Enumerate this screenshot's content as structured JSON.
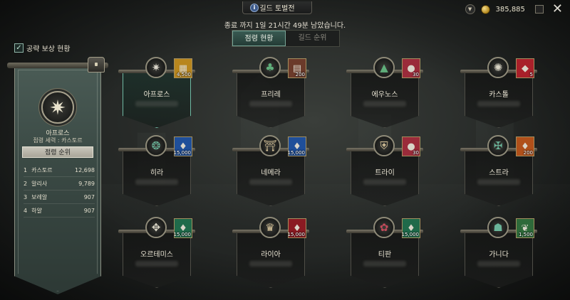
{
  "title": "길드 토벌전",
  "top_right": {
    "currency_value": "385,885"
  },
  "time_text": "종료 까지 1일 21시간 49분 남았습니다.",
  "tabs": [
    {
      "label": "점령 현황",
      "active": true
    },
    {
      "label": "길드 순위",
      "active": false
    }
  ],
  "reward_status_label": "공략 보상 현황",
  "left_panel": {
    "faction_name": "아프로스",
    "faction_sub": "점령 세력 : 카스토르",
    "rank_header": "점령 순위",
    "ranks": [
      {
        "rank": "1",
        "name": "카스토르",
        "score": "12,698"
      },
      {
        "rank": "2",
        "name": "알리사",
        "score": "9,789"
      },
      {
        "rank": "3",
        "name": "보레알",
        "score": "907"
      },
      {
        "rank": "4",
        "name": "하얄",
        "score": "907"
      }
    ]
  },
  "regions": [
    {
      "name": "아프로스",
      "count": "4,500",
      "emblem_icon": "star-emblem-icon",
      "item_icon": "gold-bars-icon",
      "item_color": "#b8861e",
      "selected": true
    },
    {
      "name": "프리레",
      "count": "200",
      "emblem_icon": "leaf-emblem-icon",
      "item_icon": "book-icon",
      "item_color": "#6b3a2a",
      "selected": false
    },
    {
      "name": "에우노스",
      "count": "30",
      "emblem_icon": "triangle-emblem-icon",
      "item_icon": "ore-icon",
      "item_color": "#9a2b3a",
      "selected": false
    },
    {
      "name": "카스톨",
      "count": "5",
      "emblem_icon": "sun-emblem-icon",
      "item_icon": "red-gem-icon",
      "item_color": "#a8202a",
      "selected": false
    },
    {
      "name": "히라",
      "count": "15,000",
      "emblem_icon": "wreath-emblem-icon",
      "item_icon": "blue-crystal-icon",
      "item_color": "#1f4f9a",
      "selected": false
    },
    {
      "name": "네메라",
      "count": "15,000",
      "emblem_icon": "torii-emblem-icon",
      "item_icon": "blue-crystal-icon",
      "item_color": "#1f4f9a",
      "selected": false
    },
    {
      "name": "트라이",
      "count": "30",
      "emblem_icon": "shield-emblem-icon",
      "item_icon": "ore-icon",
      "item_color": "#9a2b3a",
      "selected": false
    },
    {
      "name": "스트라",
      "count": "200",
      "emblem_icon": "cross-emblem-icon",
      "item_icon": "orange-crystal-icon",
      "item_color": "#b0501a",
      "selected": false
    },
    {
      "name": "오르테미스",
      "count": "15,000",
      "emblem_icon": "wing-emblem-icon",
      "item_icon": "green-crystal-icon",
      "item_color": "#1f6a4a",
      "selected": false
    },
    {
      "name": "라이아",
      "count": "15,000",
      "emblem_icon": "crown-emblem-icon",
      "item_icon": "red-crystal-icon",
      "item_color": "#8a1a22",
      "selected": false
    },
    {
      "name": "티판",
      "count": "15,000",
      "emblem_icon": "flower-emblem-icon",
      "item_icon": "green-crystal-icon",
      "item_color": "#1f6a4a",
      "selected": false
    },
    {
      "name": "가니다",
      "count": "1,500",
      "emblem_icon": "helm-emblem-icon",
      "item_icon": "green-herb-icon",
      "item_color": "#2e6a3a",
      "selected": false
    }
  ]
}
